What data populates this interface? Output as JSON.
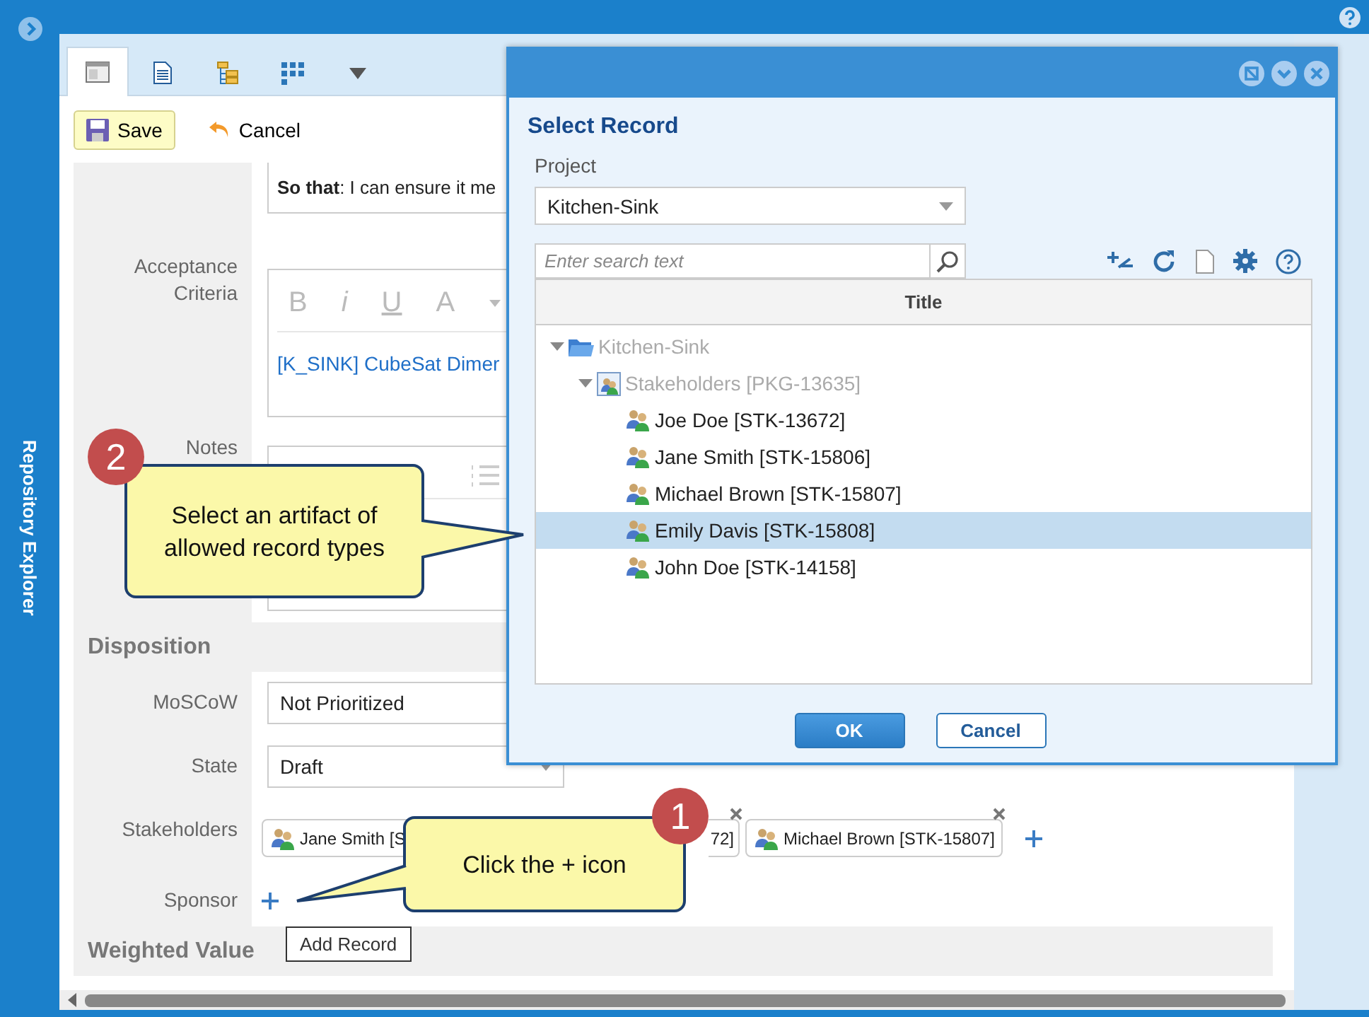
{
  "sidebar": {
    "title": "Repository Explorer"
  },
  "tabs": [
    {
      "kind": "form",
      "selected": true
    },
    {
      "kind": "document",
      "selected": false
    },
    {
      "kind": "tree",
      "selected": false
    },
    {
      "kind": "grid",
      "selected": false
    },
    {
      "kind": "more",
      "selected": false
    }
  ],
  "toolbar": [
    {
      "kind": "save",
      "label": "Save"
    },
    {
      "kind": "cancel",
      "label": "Cancel"
    }
  ],
  "form": {
    "story_fragment": "**So that**: I can ensure it me",
    "editors": [
      {
        "label": "Acceptance Criteria",
        "toolbar": [
          "B",
          "i",
          "U",
          "A"
        ],
        "content": "[K_SINK] CubeSat Dimer"
      },
      {
        "label": "Notes"
      }
    ],
    "disposition": {
      "title": "Disposition",
      "fields": [
        {
          "label": "MoSCoW",
          "value": "Not Prioritized"
        },
        {
          "label": "State",
          "value": "Draft"
        }
      ]
    },
    "stakeholders": {
      "label": "Stakeholders",
      "chips": [
        {
          "text": "Jane Smith [S"
        },
        {
          "text": "72]"
        },
        {
          "text": "Michael Brown [STK-15807]"
        }
      ]
    },
    "sponsor": {
      "label": "Sponsor"
    },
    "next_section": "Weighted Value"
  },
  "dialog": {
    "title": "Select Record",
    "project_label": "Project",
    "project": "Kitchen-Sink",
    "search": {
      "placeholder": "Enter search text"
    },
    "column": "Title",
    "tree": [
      {
        "kind": "folder",
        "label": "Kitchen-Sink",
        "disabled": true,
        "expanded": true,
        "selected": false,
        "children": [
          {
            "kind": "package",
            "label": "Stakeholders [PKG-13635]",
            "disabled": true,
            "expanded": true,
            "selected": false,
            "children": [
              {
                "kind": "person",
                "label": "Joe Doe [STK-13672]",
                "disabled": false,
                "selected": false
              },
              {
                "kind": "person",
                "label": "Jane Smith [STK-15806]",
                "disabled": false,
                "selected": false
              },
              {
                "kind": "person",
                "label": "Michael Brown [STK-15807]",
                "disabled": false,
                "selected": false
              },
              {
                "kind": "person",
                "label": "Emily Davis [STK-15808]",
                "disabled": false,
                "selected": true
              },
              {
                "kind": "person",
                "label": "John Doe [STK-14158]",
                "disabled": false,
                "selected": false
              }
            ]
          }
        ]
      }
    ],
    "buttons": [
      {
        "kind": "primary",
        "label": "OK"
      },
      {
        "kind": "secondary",
        "label": "Cancel"
      }
    ]
  },
  "callouts": [
    {
      "number": "2",
      "text": "Select an artifact of allowed record types"
    },
    {
      "number": "1",
      "text": "Click the + icon"
    }
  ],
  "tooltip": "Add Record"
}
